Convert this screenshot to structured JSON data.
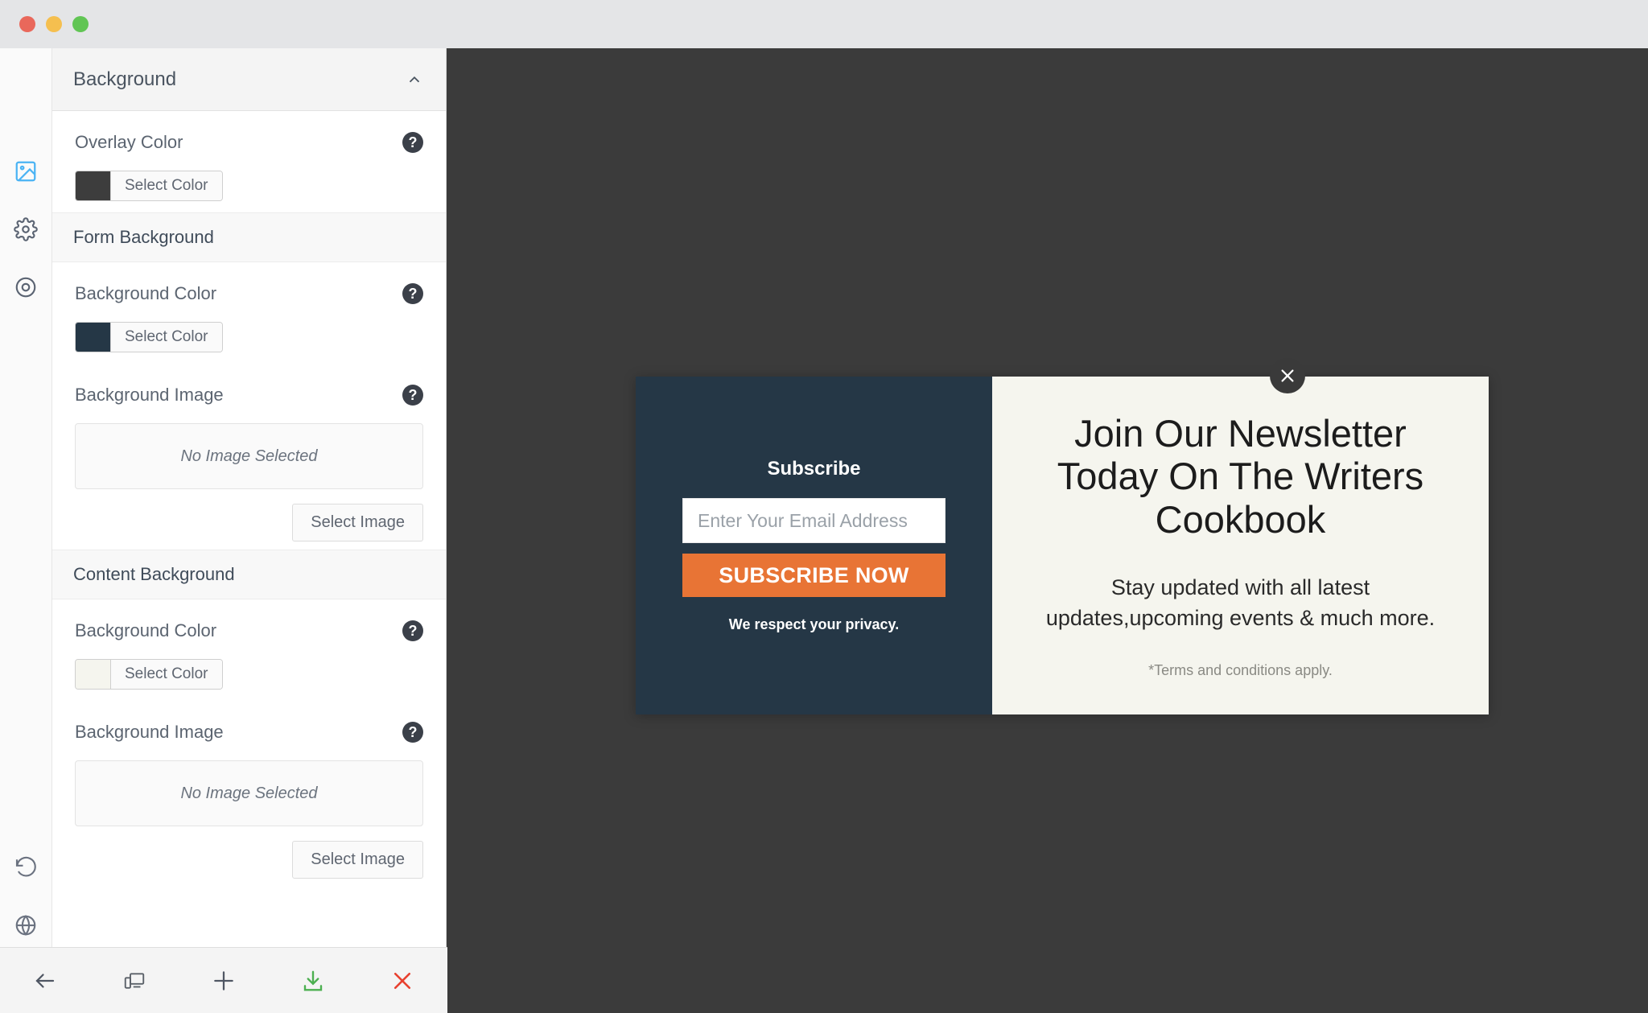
{
  "window": {
    "traffic_lights": [
      "close",
      "minimize",
      "maximize"
    ]
  },
  "rail": {
    "items": [
      {
        "icon": "image-icon",
        "name": "background",
        "active": true
      },
      {
        "icon": "gear-icon",
        "name": "settings",
        "active": false
      },
      {
        "icon": "target-icon",
        "name": "display-rules",
        "active": false
      }
    ],
    "bottom_items": [
      {
        "icon": "history-revert-icon",
        "name": "revision-history"
      },
      {
        "icon": "globe-icon",
        "name": "translations"
      }
    ]
  },
  "panel": {
    "header": {
      "title": "Background",
      "chevron": "chevron-up-icon"
    },
    "overlay": {
      "label": "Overlay Color",
      "help": "?",
      "swatch_color": "#3d3d3d",
      "button_label": "Select Color"
    },
    "form_background": {
      "section_title": "Form Background",
      "color": {
        "label": "Background Color",
        "help": "?",
        "swatch_color": "#253746",
        "button_label": "Select Color"
      },
      "image": {
        "label": "Background Image",
        "help": "?",
        "placeholder": "No Image Selected",
        "button_label": "Select Image"
      }
    },
    "content_background": {
      "section_title": "Content Background",
      "color": {
        "label": "Background Color",
        "help": "?",
        "swatch_color": "#f5f5ee",
        "button_label": "Select Color"
      },
      "image": {
        "label": "Background Image",
        "help": "?",
        "placeholder": "No Image Selected",
        "button_label": "Select Image"
      }
    }
  },
  "toolbar": {
    "items": [
      {
        "icon": "back-arrow-icon",
        "name": "back"
      },
      {
        "icon": "responsive-device-icon",
        "name": "responsive-preview"
      },
      {
        "icon": "plus-icon",
        "name": "add"
      },
      {
        "icon": "download-icon",
        "name": "save",
        "color": "#4caf50"
      },
      {
        "icon": "close-x-icon",
        "name": "close",
        "color": "#e8412f"
      }
    ]
  },
  "preview": {
    "popup": {
      "close_icon": "close-x-icon",
      "form": {
        "title": "Subscribe",
        "email_placeholder": "Enter Your Email Address",
        "email_value": "",
        "submit_label": "SUBSCRIBE NOW",
        "privacy_note": "We respect your privacy.",
        "background_color": "#253746",
        "button_color": "#e87435"
      },
      "content": {
        "heading": "Join Our Newsletter Today On The Writers Cookbook",
        "subheading": "Stay updated with all latest updates,upcoming events & much more.",
        "terms": "*Terms and conditions apply.",
        "background_color": "#f5f5ee"
      }
    },
    "canvas_color": "#3b3b3b"
  }
}
